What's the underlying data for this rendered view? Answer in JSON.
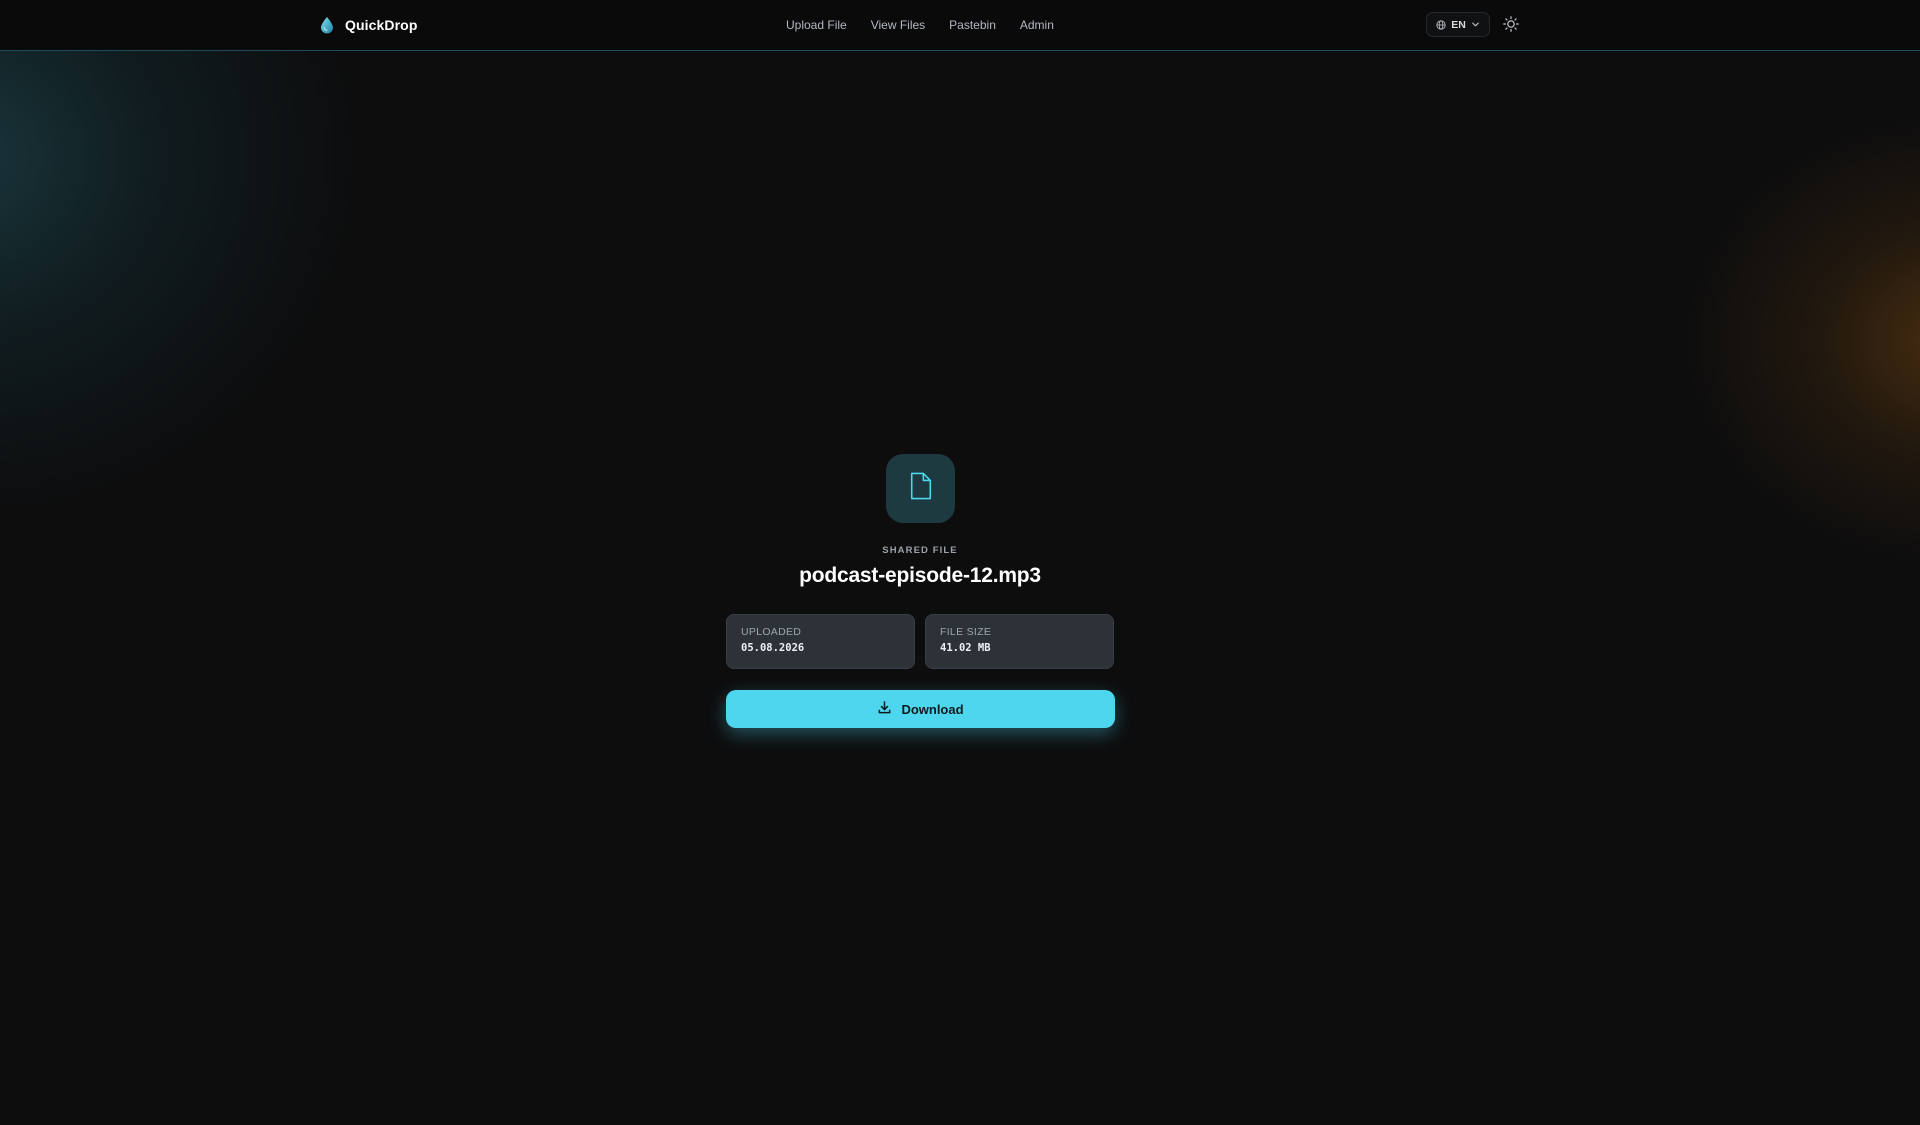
{
  "app": {
    "name": "QuickDrop",
    "logo_icon": "droplet-icon",
    "accent_color": "#4dd6ee",
    "secondary_glow_color": "#7a4a14"
  },
  "header": {
    "nav": [
      {
        "label": "Upload File"
      },
      {
        "label": "View Files"
      },
      {
        "label": "Pastebin"
      },
      {
        "label": "Admin"
      }
    ],
    "language": {
      "code": "EN",
      "icon": "globe-icon",
      "dropdown_icon": "chevron-down-icon"
    },
    "theme_toggle_icon": "sun-icon"
  },
  "file": {
    "icon": "file-icon",
    "eyebrow": "SHARED FILE",
    "name": "podcast-episode-12.mp3",
    "meta": {
      "uploaded_label": "UPLOADED",
      "uploaded_value": "05.08.2026",
      "size_label": "FILE SIZE",
      "size_value": "41.02 MB"
    },
    "download": {
      "label": "Download",
      "icon": "download-icon"
    }
  }
}
